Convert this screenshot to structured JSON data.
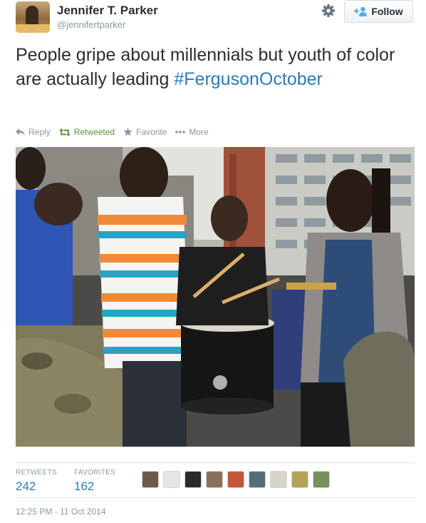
{
  "author": {
    "name": "Jennifer T. Parker",
    "handle": "@jennifertparker"
  },
  "header": {
    "settings_icon": "gear-icon",
    "follow_label": "Follow",
    "follow_icon": "add-user-icon"
  },
  "tweet": {
    "text": "People gripe about millennials but youth of color are actually leading",
    "hashtag": "#FergusonOctober"
  },
  "actions": {
    "reply": "Reply",
    "retweeted": "Retweeted",
    "favorite": "Favorite",
    "more": "More"
  },
  "photo": {
    "subject": "youth drumming at a street protest"
  },
  "stats": {
    "retweets_label": "RETWEETS",
    "retweets_count": "242",
    "favorites_label": "FAVORITES",
    "favorites_count": "162"
  },
  "favoriters": [
    "#6e5a4a",
    "#e8e6e0",
    "#2a2a2a",
    "#8a6f5a",
    "#c4553b",
    "#556b7a",
    "#d9d4c8",
    "#b8a05a",
    "#7a8f5a"
  ],
  "timestamp": "12:25 PM - 11 Oct 2014",
  "colors": {
    "link": "#2b7bb9",
    "retweeted": "#5c913b",
    "muted": "#8899a6",
    "text": "#292f33"
  }
}
